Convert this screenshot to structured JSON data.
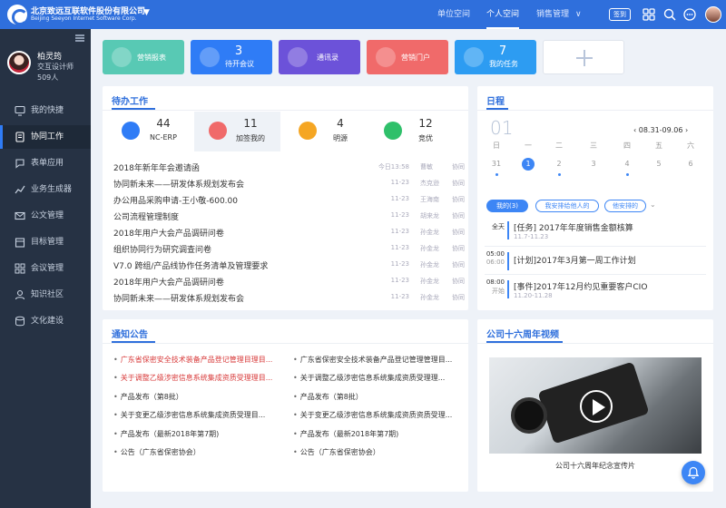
{
  "header": {
    "company_cn": "北京致远互联软件股份有限公司",
    "company_en": "Beijing Seeyon Internet Software Corp.",
    "nav": [
      "单位空间",
      "个人空间",
      "销售管理"
    ],
    "active_nav": "个人空间",
    "sign_label": "签到",
    "icons": [
      "grid-icon",
      "search-icon",
      "message-icon",
      "settings-icon",
      "avatar"
    ],
    "accent_color": "#2f6fdc"
  },
  "user": {
    "name": "柏灵筠",
    "title": "交互设计师",
    "count": "509人"
  },
  "sidebar": {
    "items": [
      {
        "label": "我的快捷",
        "icon": "monitor-icon"
      },
      {
        "label": "协同工作",
        "icon": "document-icon",
        "active": true
      },
      {
        "label": "表单应用",
        "icon": "chat-icon"
      },
      {
        "label": "业务生成器",
        "icon": "chart-line-icon"
      },
      {
        "label": "公文管理",
        "icon": "mail-icon"
      },
      {
        "label": "目标管理",
        "icon": "calendar-icon"
      },
      {
        "label": "会议管理",
        "icon": "grid-icon"
      },
      {
        "label": "知识社区",
        "icon": "people-icon"
      },
      {
        "label": "文化建设",
        "icon": "database-icon"
      }
    ]
  },
  "tiles": [
    {
      "label": "营销报表",
      "number": "",
      "color": "#58c9b4"
    },
    {
      "label": "待开会议",
      "number": "3",
      "color": "#2f7cf6"
    },
    {
      "label": "通讯录",
      "number": "",
      "color": "#6c52d9"
    },
    {
      "label": "营销门户",
      "number": "",
      "color": "#f06a6a"
    },
    {
      "label": "我的任务",
      "number": "7",
      "color": "#2d9cf2"
    }
  ],
  "todo": {
    "title": "待办工作",
    "tabs": [
      {
        "number": "44",
        "label": "NC-ERP",
        "color": "#2f7cf6"
      },
      {
        "number": "11",
        "label": "加签我的",
        "color": "#f06a6a",
        "active": true
      },
      {
        "number": "4",
        "label": "明源",
        "color": "#f5a623"
      },
      {
        "number": "12",
        "label": "竞优",
        "color": "#2fc06a"
      }
    ],
    "rows": [
      {
        "title": "2018年新年年会邀请函",
        "date": "今日13:58",
        "person": "曹敏",
        "category": "协同"
      },
      {
        "title": "协同新未来——研发体系规划发布会",
        "date": "11-23",
        "person": "杰克逊",
        "category": "协同"
      },
      {
        "title": "办公用品采购申请-王小敬-600.00",
        "date": "11-23",
        "person": "王海南",
        "category": "协同"
      },
      {
        "title": "公司流程管理制度",
        "date": "11-23",
        "person": "胡来龙",
        "category": "协同"
      },
      {
        "title": "2018年用户大会产品调研问卷",
        "date": "11-23",
        "person": "孙金龙",
        "category": "协同"
      },
      {
        "title": "组织协同行为研究调查问卷",
        "date": "11-23",
        "person": "孙金龙",
        "category": "协同"
      },
      {
        "title": "V7.0 跨组/产品线协作任务清单及管理要求",
        "date": "11-23",
        "person": "孙金龙",
        "category": "协同"
      },
      {
        "title": "2018年用户大会产品调研问卷",
        "date": "11-23",
        "person": "孙金龙",
        "category": "协同"
      },
      {
        "title": "协同新未来——研发体系规划发布会",
        "date": "11-23",
        "person": "孙金龙",
        "category": "协同"
      }
    ]
  },
  "schedule": {
    "title": "日程",
    "month": "01",
    "range": "08.31-09.06",
    "weekdays": [
      "日",
      "一",
      "二",
      "三",
      "四",
      "五",
      "六"
    ],
    "days": [
      "31",
      "1",
      "2",
      "3",
      "4",
      "5",
      "6"
    ],
    "selected_day": "1",
    "tabs": [
      "我的(3)",
      "我安排给他人的",
      "他安排的"
    ],
    "events": [
      {
        "time": "全天",
        "time2": "",
        "title": "[任务] 2017年年度销售金额核算",
        "date": "11.7-11.23"
      },
      {
        "time": "05:00",
        "time2": "06:00",
        "title": "[计划]2017年3月第一周工作计划",
        "date": ""
      },
      {
        "time": "08:00",
        "time2": "开始",
        "title": "[事件]2017年12月约见重要客户CIO",
        "date": "11.20-11.28"
      }
    ]
  },
  "notices": {
    "title": "通知公告",
    "left": [
      {
        "text": "广东省保密安全技术装备产品登记管理目理目...",
        "hot": true
      },
      {
        "text": "关于调整乙级涉密信息系统集成资质受理理目...",
        "hot": true
      },
      {
        "text": "产品发布（第8批）",
        "hot": false
      },
      {
        "text": "关于变更乙级涉密信息系统集成资质受理目...",
        "hot": false
      },
      {
        "text": "产品发布（最新2018年第7期)",
        "hot": false
      },
      {
        "text": "公告（广东省保密协会）",
        "hot": false
      }
    ],
    "right": [
      {
        "text": "广东省保密安全技术装备产品登记管理管理目...",
        "hot": false
      },
      {
        "text": "关于调整乙级涉密信息系统集成资质受理理...",
        "hot": false
      },
      {
        "text": "产品发布（第8批）",
        "hot": false
      },
      {
        "text": "关于变更乙级涉密信息系统集成资质资质受理...",
        "hot": false
      },
      {
        "text": "产品发布（最新2018年第7期)",
        "hot": false
      },
      {
        "text": "公告（广东省保密协会）",
        "hot": false
      }
    ]
  },
  "video": {
    "title": "公司十六周年视频",
    "caption": "公司十六周年纪念宣传片"
  }
}
